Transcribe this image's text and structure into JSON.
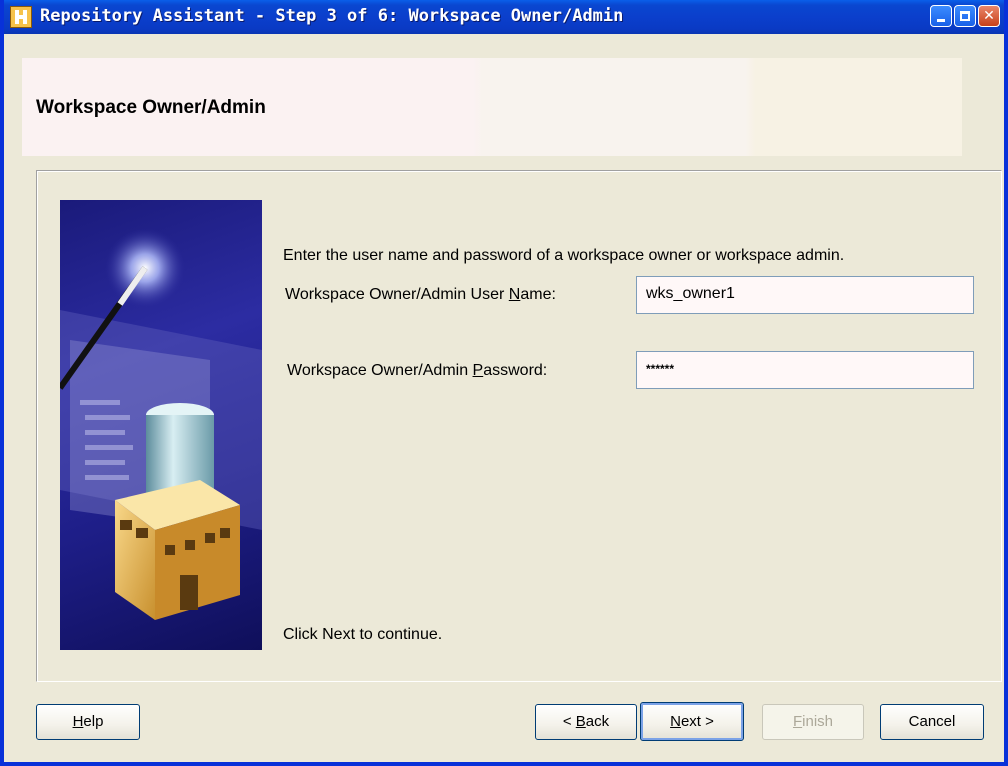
{
  "window": {
    "title": "Repository Assistant - Step 3 of 6: Workspace Owner/Admin"
  },
  "header": {
    "title": "Workspace Owner/Admin"
  },
  "content": {
    "instruction": "Enter the user name and password of a workspace owner or workspace admin.",
    "username_label_pre": "Workspace Owner/Admin User ",
    "username_label_acc": "N",
    "username_label_post": "ame:",
    "username_value": "wks_owner1",
    "password_label_pre": "Workspace Owner/Admin ",
    "password_label_acc": "P",
    "password_label_post": "assword:",
    "password_value": "******",
    "footer": "Click Next to continue."
  },
  "buttons": {
    "help_acc": "H",
    "help_rest": "elp",
    "back_pre": "< ",
    "back_acc": "B",
    "back_rest": "ack",
    "next_acc": "N",
    "next_rest": "ext >",
    "finish_acc": "F",
    "finish_rest": "inish",
    "cancel": "Cancel"
  },
  "colors": {
    "titlebar": "#0b3fcc",
    "dialog_bg": "#ece9d8",
    "illustration_bg": "#1e1e88"
  }
}
